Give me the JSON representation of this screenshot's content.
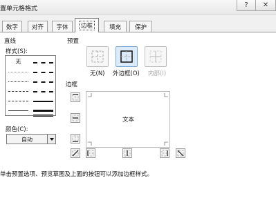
{
  "window": {
    "title": "置单元格格式",
    "help": "?",
    "close": "✕"
  },
  "tabs": [
    {
      "label": "数字",
      "active": false
    },
    {
      "label": "对齐",
      "active": false
    },
    {
      "label": "字体",
      "active": false
    },
    {
      "label": "边框",
      "active": true
    },
    {
      "label": "填充",
      "active": false
    },
    {
      "label": "保护",
      "active": false
    }
  ],
  "line": {
    "section_label": "直线",
    "style_label": "样式(S):",
    "none_label": "无",
    "color_label": "颜色(C):",
    "color_value": "自动"
  },
  "presets": {
    "section_label": "预置",
    "items": [
      {
        "label": "无(N)",
        "enabled": true,
        "icon": "border-none-icon"
      },
      {
        "label": "外边框(O)",
        "enabled": true,
        "icon": "border-outline-icon"
      },
      {
        "label": "内部(I)",
        "enabled": false,
        "icon": "border-inside-icon"
      }
    ]
  },
  "border": {
    "section_label": "边框",
    "preview_text": "文本"
  },
  "hint": "单击预置选项、预览草图及上面的按钮可以添加边框样式。"
}
